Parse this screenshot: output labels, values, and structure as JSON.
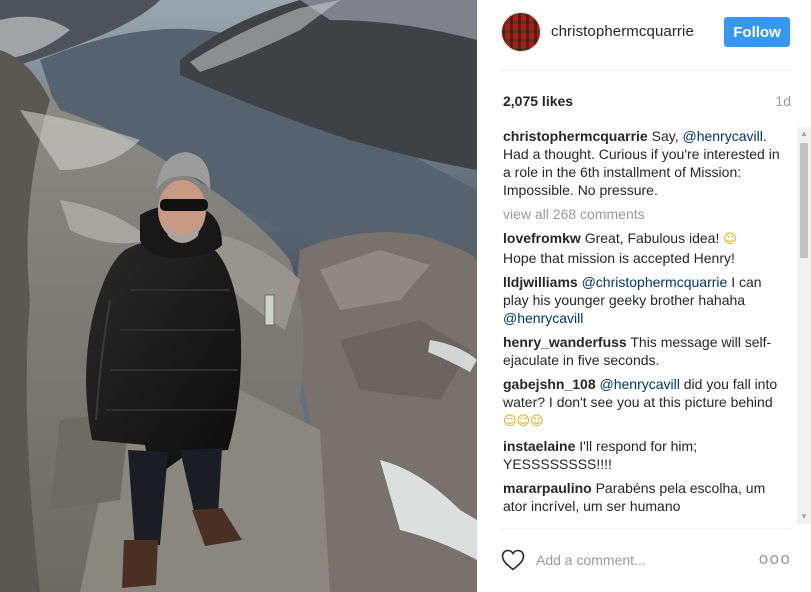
{
  "post": {
    "username": "christophermcquarrie",
    "follow_label": "Follow",
    "likes": "2,075 likes",
    "time_ago": "1d",
    "caption": {
      "user": "christophermcquarrie",
      "text_1": " Say, ",
      "mention_1": "@henrycavill",
      "text_2": ". Had a thought. Curious if you're interested in a role in the 6th installment of Mission: Impossible. No pressure."
    },
    "view_all": "view all 268 comments",
    "comments": [
      {
        "user": "lovefromkw",
        "text_1": " Great, Fabulous idea! ",
        "emoji": "☺",
        "text_2": " Hope that mission is accepted Henry!"
      },
      {
        "user": "lldjwilliams",
        "mention_1": "@christophermcquarrie",
        "text_1": " I can play his younger geeky brother hahaha ",
        "mention_2": "@henrycavill"
      },
      {
        "user": "henry_wanderfuss",
        "text_1": " This message will self-ejaculate in five seconds."
      },
      {
        "user": "gabejshn_108",
        "mention_1": "@henrycavill",
        "text_1": " did you fall into water? I don't see you at this picture behind ",
        "emoji": "☺☺☺"
      },
      {
        "user": "instaelaine",
        "text_1": " I'll respond for him; YESSSSSSSS!!!!"
      },
      {
        "user": "mararpaulino",
        "text_1": " Parabéns pela escolha, um ator incrível, um ser humano"
      }
    ],
    "add_comment_placeholder": "Add a comment...",
    "more_options": "ooo"
  },
  "icons": {
    "heart": "heart-outline-icon",
    "more": "more-options-icon",
    "scroll_up": "scroll-up-arrow-icon",
    "scroll_down": "scroll-down-arrow-icon"
  },
  "colors": {
    "follow_button": "#3897f0",
    "mention": "#003569",
    "muted": "#999999"
  }
}
